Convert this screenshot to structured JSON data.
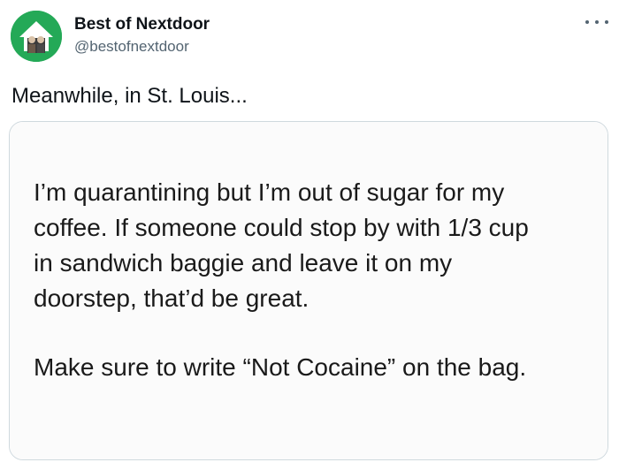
{
  "author": {
    "display_name": "Best of Nextdoor",
    "handle": "@bestofnextdoor",
    "avatar_icon": "house-avatar-icon",
    "avatar_color": "#24a957"
  },
  "menu": {
    "icon": "more-options-icon"
  },
  "tweet": {
    "text": "Meanwhile, in St. Louis..."
  },
  "screenshot_post": {
    "paragraph_1": "I’m quarantining but I’m out of sugar for my\ncoffee. If someone could stop by with 1/3 cup\nin sandwich baggie and leave it on my\ndoorstep, that’d be great.",
    "paragraph_2": "Make sure to write “Not Cocaine” on the bag."
  }
}
